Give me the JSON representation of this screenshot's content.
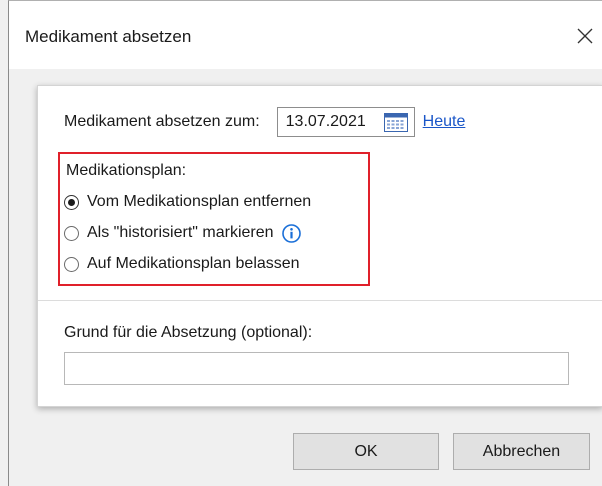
{
  "window": {
    "title": "Medikament absetzen",
    "close_icon": "close-icon"
  },
  "date_row": {
    "label": "Medikament absetzen zum:",
    "date_value": "13.07.2021",
    "calendar_icon": "calendar-icon",
    "today_link": "Heute"
  },
  "plan": {
    "title": "Medikationsplan:",
    "options": [
      {
        "label": "Vom Medikationsplan entfernen",
        "selected": true
      },
      {
        "label": "Als \"historisiert\" markieren",
        "selected": false,
        "info_icon": "info-icon"
      },
      {
        "label": "Auf Medikationsplan belassen",
        "selected": false
      }
    ]
  },
  "reason": {
    "label": "Grund für die Absetzung (optional):",
    "value": ""
  },
  "buttons": {
    "ok": "OK",
    "cancel": "Abbrechen"
  },
  "colors": {
    "highlight_border": "#e0202a",
    "link": "#1a56c8",
    "info_icon": "#1a6fd8"
  }
}
